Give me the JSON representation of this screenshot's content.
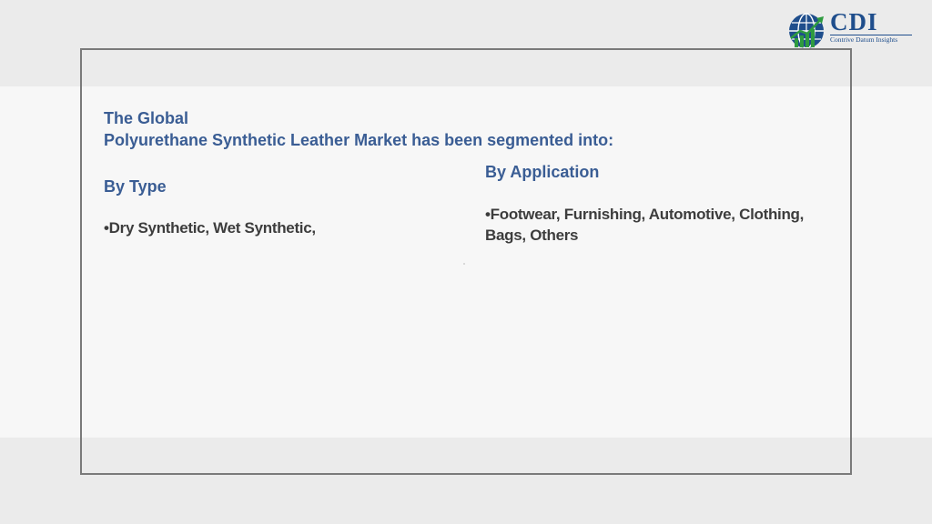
{
  "logo": {
    "name": "CDI",
    "tagline": "Contrive Datum Insights",
    "icon": "globe-chart-icon",
    "colors": {
      "primary": "#1f4e8c",
      "accent": "#2e9b3f"
    }
  },
  "heading": {
    "line1": "The Global",
    "line2": "Polyurethane Synthetic Leather Market has been segmented into:"
  },
  "by_type": {
    "title": "By Type",
    "items": "•Dry Synthetic, Wet Synthetic,"
  },
  "by_application": {
    "title": "By Application",
    "items_line1": "•Footwear, Furnishing, Automotive, Clothing,",
    "items_line2": "Bags, Others"
  },
  "colors": {
    "heading": "#3a5d94",
    "body_text": "#3d3d3d",
    "frame": "#7a7a7a"
  }
}
